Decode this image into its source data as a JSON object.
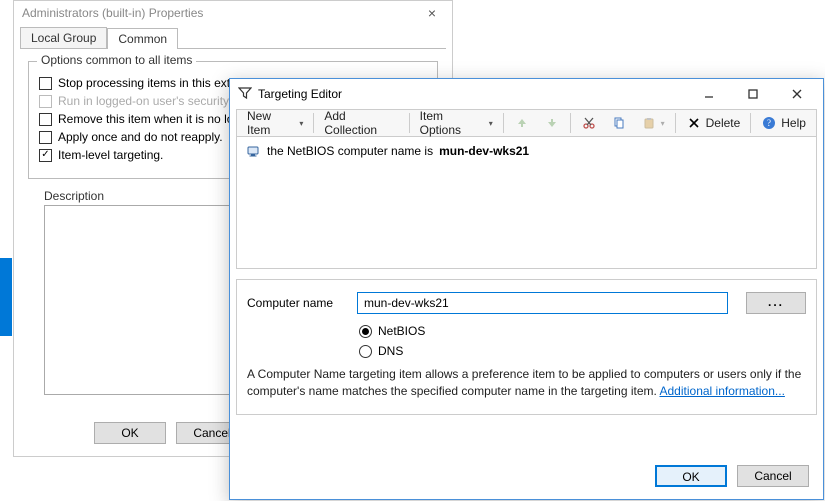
{
  "properties": {
    "title": "Administrators (built-in) Properties",
    "close_glyph": "×",
    "tabs": [
      "Local Group",
      "Common"
    ],
    "options_legend": "Options common to all items",
    "options": [
      {
        "label": "Stop processing items in this extension if an error occurs.",
        "checked": false,
        "enabled": true
      },
      {
        "label": "Run in logged-on user's security context (user policy option).",
        "checked": false,
        "enabled": false
      },
      {
        "label": "Remove this item when it is no longer applied.",
        "checked": false,
        "enabled": true
      },
      {
        "label": "Apply once and do not reapply.",
        "checked": false,
        "enabled": true
      },
      {
        "label": "Item-level targeting.",
        "checked": true,
        "enabled": true
      }
    ],
    "description_label": "Description",
    "buttons": {
      "ok": "OK",
      "cancel": "Cancel"
    }
  },
  "dialog": {
    "title": "Targeting Editor",
    "toolbar": {
      "new_item": "New Item",
      "add_collection": "Add Collection",
      "item_options": "Item Options",
      "delete": "Delete",
      "help": "Help"
    },
    "rule": {
      "prefix": "the NetBIOS computer name is",
      "value": "mun-dev-wks21"
    },
    "form": {
      "computer_name_label": "Computer name",
      "computer_name_value": "mun-dev-wks21",
      "browse_label": "...",
      "radio_netbios": "NetBIOS",
      "radio_dns": "DNS",
      "selected_radio": "netbios"
    },
    "help": {
      "text": "A Computer Name targeting item allows a preference item to be applied to computers or users only if the computer's name matches the specified computer name in the targeting item.  ",
      "link": "Additional information..."
    },
    "buttons": {
      "ok": "OK",
      "cancel": "Cancel"
    }
  }
}
